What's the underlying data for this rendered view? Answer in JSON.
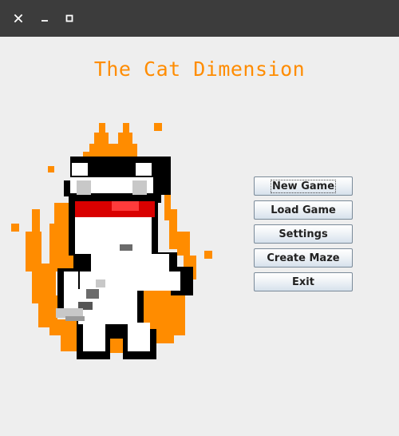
{
  "window": {
    "controls": [
      {
        "name": "close",
        "icon": "close-icon"
      },
      {
        "name": "minimize",
        "icon": "minimize-icon"
      },
      {
        "name": "maximize",
        "icon": "maximize-icon"
      }
    ]
  },
  "app": {
    "title": "The Cat Dimension",
    "title_color": "#ff8c00",
    "logo": "cat-on-fire-pixel-art"
  },
  "menu": {
    "buttons": [
      {
        "label": "New Game",
        "focused": true
      },
      {
        "label": "Load Game",
        "focused": false
      },
      {
        "label": "Settings",
        "focused": false
      },
      {
        "label": "Create Maze",
        "focused": false
      },
      {
        "label": "Exit",
        "focused": false
      }
    ]
  },
  "colors": {
    "titlebar": "#3c3c3c",
    "background": "#eeeeee",
    "fire": "#ff8c00",
    "headband": "#d90000"
  }
}
